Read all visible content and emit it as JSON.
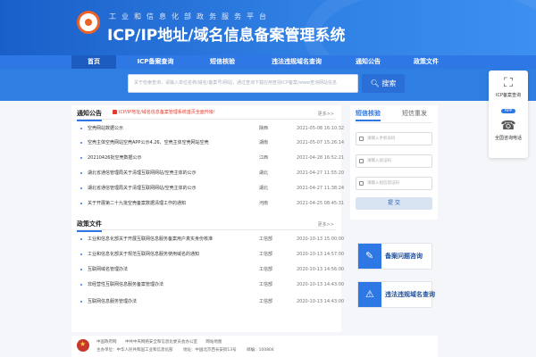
{
  "header": {
    "ministry": "工业和信息化部政务服务平台",
    "title": "ICP/IP地址/域名信息备案管理系统"
  },
  "nav": {
    "items": [
      {
        "label": "首页",
        "active": true
      },
      {
        "label": "ICP备案查询",
        "active": false
      },
      {
        "label": "短信核验",
        "active": false
      },
      {
        "label": "违法违规域名查询",
        "active": false
      },
      {
        "label": "通知公告",
        "active": false
      },
      {
        "label": "政策文件",
        "active": false
      }
    ]
  },
  "search": {
    "placeholder": "关于检索查询，请输入单位名称/域名/备案号/网站，通过查询下载应用查找ICP备案/www查询网站信息",
    "button_label": "搜索"
  },
  "float_panel": {
    "app_label": "ICP备案查询",
    "app_badge": "APP",
    "phone_label": "全国咨询电话"
  },
  "notices": {
    "title": "通知公告",
    "flag": "ICP/IP地址/域名信息备案管理系统首页全面升级!",
    "more": "更多>>",
    "items": [
      {
        "title": "空壳网站数据公示",
        "source": "陕西",
        "date": "2021-05-08 16:10:32"
      },
      {
        "title": "空壳主体空壳网站空壳APP公示4.26、空壳主体空壳网站空壳",
        "source": "湖南",
        "date": "2021-05-07 15:26:14"
      },
      {
        "title": "20210426批空壳数据公示",
        "source": "江西",
        "date": "2021-04-28 16:52:21"
      },
      {
        "title": "湖北省通信管理局关于清理互联网网站/空壳主体的公示",
        "source": "湖北",
        "date": "2021-04-27 11:55:20"
      },
      {
        "title": "湖北省通信管理局关于清理互联网网站/空壳主体的公示",
        "source": "湖北",
        "date": "2021-04-27 11:38:24"
      },
      {
        "title": "关于开展第二十九批空壳备案数据清理工作的通知",
        "source": "河南",
        "date": "2021-04-25 08:45:31"
      }
    ]
  },
  "policies": {
    "title": "政策文件",
    "more": "更多>>",
    "items": [
      {
        "title": "工业和信息化部关于开展互联网信息服务备案用户真实身份核准",
        "source": "工信部",
        "date": "2020-10-13 15:00:00"
      },
      {
        "title": "工业和信息化部关于规范互联网信息服务使用域名的通知",
        "source": "工信部",
        "date": "2020-10-13 14:57:00"
      },
      {
        "title": "互联网域名管理办法",
        "source": "工信部",
        "date": "2020-10-13 14:56:00"
      },
      {
        "title": "非经营性互联网信息服务备案管理办法",
        "source": "工信部",
        "date": "2020-10-13 14:43:00"
      },
      {
        "title": "互联网信息服务管理办法",
        "source": "工信部",
        "date": "2020-10-13 14:43:00"
      }
    ]
  },
  "verify": {
    "tab_active": "短信核验",
    "tab_inactive": "短信重发",
    "phone_placeholder": "请输入手机号码",
    "code_placeholder": "请输入验证码",
    "sms_placeholder": "请输入短信验证码",
    "submit_label": "提 交"
  },
  "cards": [
    {
      "label": "备案问题咨询",
      "icon": "consult-icon"
    },
    {
      "label": "违法违规域名查询",
      "icon": "warning-icon"
    }
  ],
  "footer": {
    "links": [
      "中国政府网",
      "中共中央网络安全和信息化委员会办公室",
      "网站地图"
    ],
    "line2": [
      "主办单位：中华人民共和国工业和信息化部",
      "地址：中国北京西长安街13号",
      "邮编：100804"
    ]
  },
  "colors": {
    "brand_blue": "#2e78e6",
    "header_dark": "#1a5fc9",
    "logo_orange": "#e8622a",
    "alert_red": "#e23b2e"
  }
}
